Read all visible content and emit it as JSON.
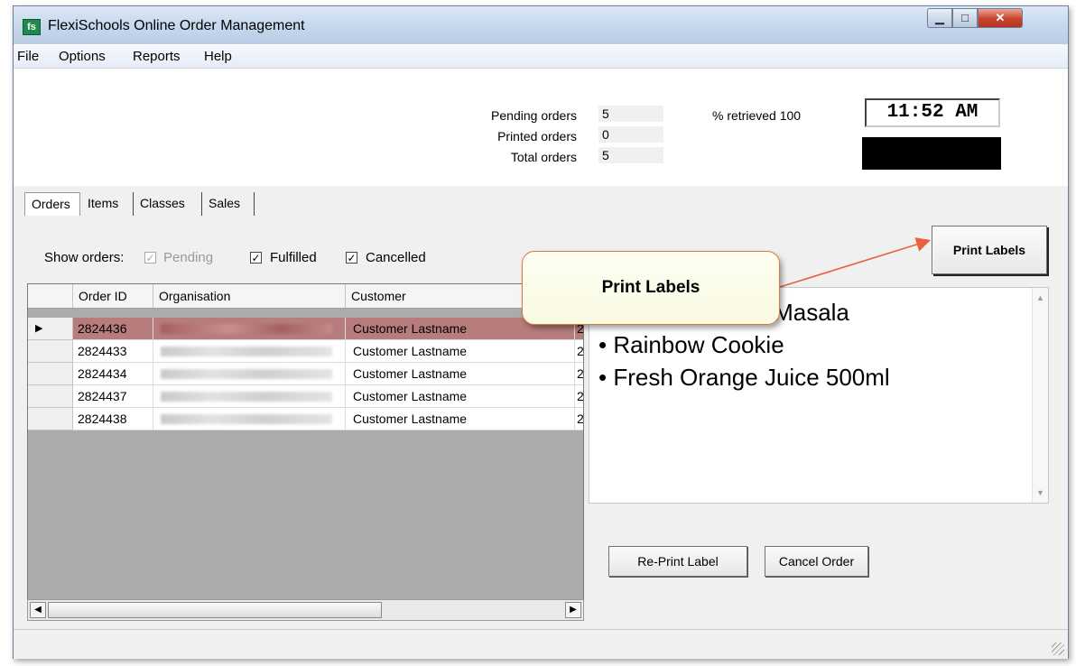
{
  "window": {
    "title": "FlexiSchools Online Order Management",
    "icon_text": "fs",
    "controls": {
      "minimize": "▁",
      "maximize": "□",
      "close": "✕"
    }
  },
  "menu": [
    "File",
    "Options",
    "Reports",
    "Help"
  ],
  "stats": {
    "pending_label": "Pending orders",
    "pending_value": "5",
    "printed_label": "Printed orders",
    "printed_value": "0",
    "total_label": "Total orders",
    "total_value": "5",
    "retrieved_label": "% retrieved 100",
    "clock": "11:52 AM"
  },
  "tabs": [
    "Orders",
    "Items",
    "Classes",
    "Sales"
  ],
  "filters": {
    "label": "Show orders:",
    "pending": "Pending",
    "fulfilled": "Fulfilled",
    "cancelled": "Cancelled",
    "check_mark": "✓"
  },
  "print_labels_button": "Print Labels",
  "grid": {
    "columns": [
      "Order ID",
      "Organisation",
      "Customer"
    ],
    "row_pointer": "▶",
    "rows": [
      {
        "order_id": "2824436",
        "customer": "Customer Lastname",
        "extra": "2"
      },
      {
        "order_id": "2824433",
        "customer": "Customer Lastname",
        "extra": "2"
      },
      {
        "order_id": "2824434",
        "customer": "Customer Lastname",
        "extra": "2"
      },
      {
        "order_id": "2824437",
        "customer": "Customer Lastname",
        "extra": "2"
      },
      {
        "order_id": "2824438",
        "customer": "Customer Lastname",
        "extra": "2"
      }
    ],
    "scroll_left": "◀",
    "scroll_right": "▶"
  },
  "items": [
    "• Butter Chicken Masala",
    "• Rainbow Cookie",
    "• Fresh Orange Juice 500ml"
  ],
  "items_scroll": {
    "up": "▲",
    "down": "▼"
  },
  "buttons": {
    "reprint": "Re-Print Label",
    "cancel": "Cancel Order"
  },
  "callout": {
    "text": "Print Labels",
    "color": "#e8603c"
  }
}
